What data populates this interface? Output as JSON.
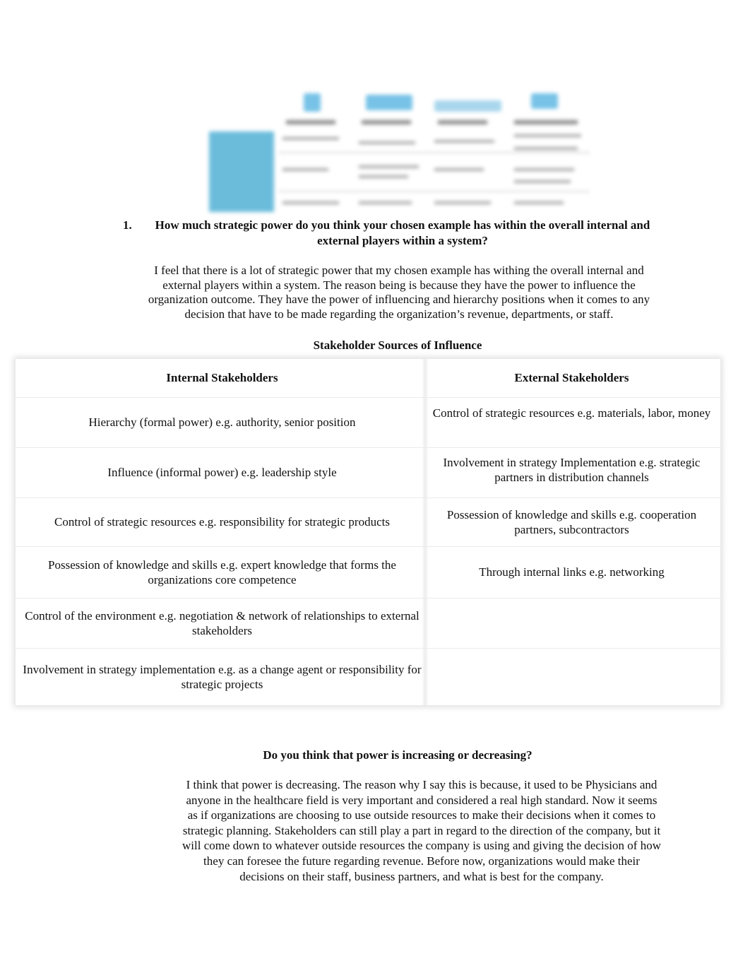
{
  "figure": {
    "description": "blurred stakeholder diagram image",
    "accent_color": "#3aa6d0"
  },
  "question1": {
    "number": "1.",
    "text": "How much strategic power do you think your chosen example has within the overall internal and external players within a system?"
  },
  "answer1": {
    "text": "I feel that there is a lot of strategic power that my chosen example has withing the overall internal and external players within a system.  The reason being is because they have the power to influence the organization outcome. They have the power of influencing and hierarchy positions when it comes to any decision that have to be made regarding the organization’s revenue, departments, or staff."
  },
  "table": {
    "title": "Stakeholder Sources of Influence",
    "headers": [
      "Internal Stakeholders",
      "External Stakeholders"
    ],
    "rows": [
      {
        "internal": "Hierarchy (formal power) e.g. authority, senior position",
        "external": "Control of strategic resources e.g. materials, labor, money"
      },
      {
        "internal": "Influence (informal power) e.g. leadership style",
        "external": "Involvement in strategy Implementation e.g. strategic partners in distribution channels"
      },
      {
        "internal": "Control of strategic resources e.g. responsibility for strategic products",
        "external": "Possession of knowledge and skills e.g. cooperation partners, subcontractors"
      },
      {
        "internal": "Possession of knowledge and skills e.g. expert knowledge that forms the organizations core competence",
        "external": "Through internal links e.g. networking"
      },
      {
        "internal": "Control of the environment e.g. negotiation & network of relationships to external stakeholders",
        "external": ""
      },
      {
        "internal": "Involvement in strategy implementation e.g. as a change agent or responsibility for strategic projects",
        "external": ""
      }
    ]
  },
  "question2": {
    "text": "Do you think that power is increasing or decreasing?"
  },
  "answer2": {
    "text": "I think that power is decreasing.  The reason why I say this is because, it used to be Physicians and anyone in the healthcare field is very important and considered a real high standard.  Now it seems as if organizations are choosing to use outside resources to make their decisions when it comes to strategic planning.  Stakeholders can still play a part in regard to the direction of the company, but it will come down to whatever outside resources the company is using and giving the decision of how they can foresee the future regarding revenue.  Before now, organizations would make their decisions on their staff, business partners, and what is best for the company."
  }
}
